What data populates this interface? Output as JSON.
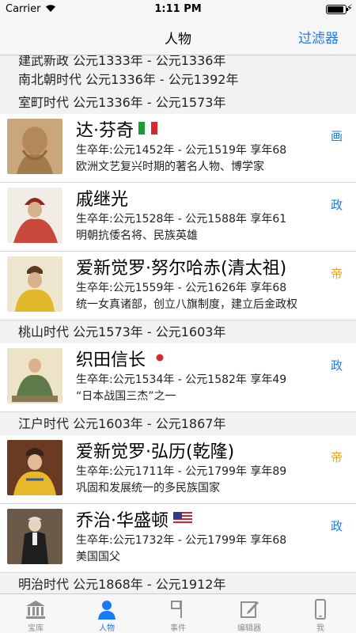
{
  "status_bar": {
    "carrier": "Carrier",
    "time": "1:11 PM",
    "battery_level": 0.9
  },
  "nav": {
    "title": "人物",
    "filter_label": "过滤器"
  },
  "colors": {
    "accent": "#1a7cf4",
    "tag_painter": "#1a7cf4",
    "tag_politics": "#1a7cf4",
    "tag_emperor": "#e8a317"
  },
  "sections": [
    {
      "title": "建武新政 公元1333年 - 公元1336年"
    },
    {
      "title": "南北朝时代 公元1336年 - 公元1392年"
    },
    {
      "title": "室町时代 公元1336年 - 公元1573年"
    },
    {
      "title": "桃山时代 公元1573年 - 公元1603年"
    },
    {
      "title": "江户时代 公元1603年 - 公元1867年"
    },
    {
      "title": "明治时代 公元1868年 - 公元1912年"
    }
  ],
  "people": [
    {
      "name": "达·芬奇",
      "flag": "italy-flag-icon",
      "life": "生卒年:公元1452年 - 公元1519年 享年68",
      "desc": "欧洲文艺复兴时期的著名人物、博学家",
      "tag": "画"
    },
    {
      "name": "戚继光",
      "flag": "",
      "life": "生卒年:公元1528年 - 公元1588年 享年61",
      "desc": "明朝抗倭名将、民族英雄",
      "tag": "政"
    },
    {
      "name": "爱新觉罗·努尔哈赤(清太祖)",
      "flag": "",
      "life": "生卒年:公元1559年 - 公元1626年 享年68",
      "desc": "统一女真诸部，创立八旗制度，建立后金政权",
      "tag": "帝"
    },
    {
      "name": "织田信长",
      "flag": "japan-flag-icon",
      "life": "生卒年:公元1534年 - 公元1582年 享年49",
      "desc": "“日本战国三杰”之一",
      "tag": "政"
    },
    {
      "name": "爱新觉罗·弘历(乾隆)",
      "flag": "",
      "life": "生卒年:公元1711年 - 公元1799年 享年89",
      "desc": "巩固和发展统一的多民族国家",
      "tag": "帝"
    },
    {
      "name": "乔治·华盛顿",
      "flag": "usa-flag-icon",
      "life": "生卒年:公元1732年 - 公元1799年 享年68",
      "desc": "美国国父",
      "tag": "政"
    }
  ],
  "tabs": [
    {
      "label": "宝库",
      "icon": "museum-icon"
    },
    {
      "label": "人物",
      "icon": "person-icon"
    },
    {
      "label": "事件",
      "icon": "flag-icon"
    },
    {
      "label": "编辑器",
      "icon": "edit-icon"
    },
    {
      "label": "我",
      "icon": "phone-icon"
    }
  ]
}
